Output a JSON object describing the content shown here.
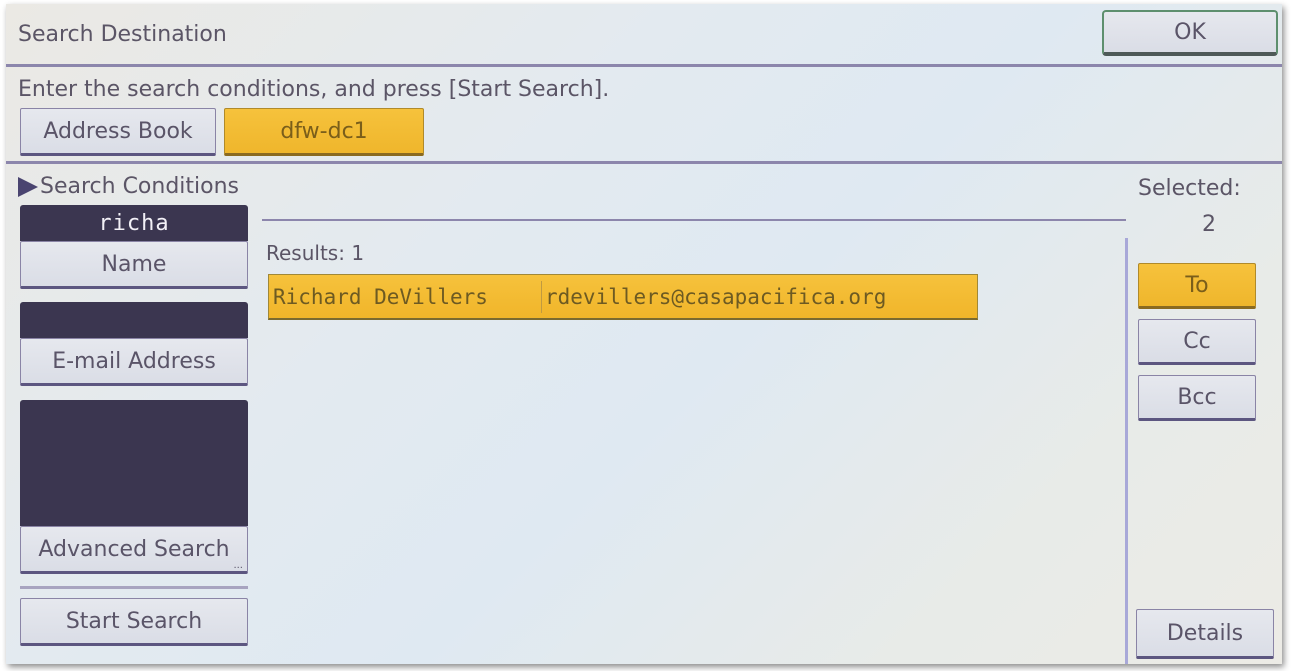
{
  "header": {
    "title": "Search Destination",
    "ok_label": "OK"
  },
  "instruction": "Enter the search conditions, and press [Start Search].",
  "source_tabs": [
    {
      "label": "Address Book",
      "selected": false
    },
    {
      "label": "dfw-dc1",
      "selected": true
    }
  ],
  "search_conditions": {
    "label": "Search Conditions",
    "name_field": {
      "value": "richa",
      "button_label": "Name"
    },
    "email_field": {
      "value": "",
      "button_label": "E-mail Address"
    },
    "advanced_field": {
      "value": "",
      "button_label": "Advanced Search",
      "ellipsis": "..."
    },
    "start_search_label": "Start Search"
  },
  "results": {
    "label": "Results: 1",
    "rows": [
      {
        "name": "Richard DeVillers",
        "email": "rdevillers@casapacifica.org",
        "selected": true
      }
    ]
  },
  "selected": {
    "label": "Selected:",
    "count": "2"
  },
  "recipient_types": [
    {
      "label": "To",
      "selected": true
    },
    {
      "label": "Cc",
      "selected": false
    },
    {
      "label": "Bcc",
      "selected": false
    }
  ],
  "details_label": "Details",
  "colors": {
    "accent_selected": "#f2b92e",
    "field_dark": "#3b3650",
    "button_face": "#dfe2ea"
  }
}
